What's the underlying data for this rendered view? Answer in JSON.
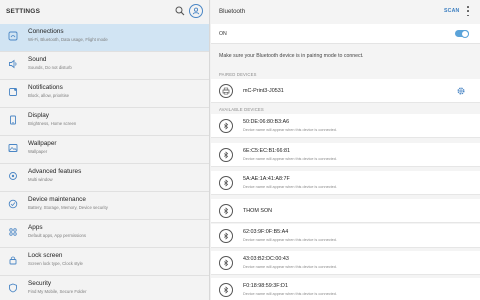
{
  "left": {
    "title": "SETTINGS",
    "items": [
      {
        "title": "Connections",
        "sub": "Wi-Fi, Bluetooth, Data usage, Flight mode",
        "icon": "connections-icon"
      },
      {
        "title": "Sound",
        "sub": "Sounds, Do not disturb",
        "icon": "sound-icon"
      },
      {
        "title": "Notifications",
        "sub": "Block, allow, prioritise",
        "icon": "notifications-icon"
      },
      {
        "title": "Display",
        "sub": "Brightness, Home screen",
        "icon": "display-icon"
      },
      {
        "title": "Wallpaper",
        "sub": "Wallpaper",
        "icon": "wallpaper-icon"
      },
      {
        "title": "Advanced features",
        "sub": "Multi window",
        "icon": "advanced-features-icon"
      },
      {
        "title": "Device maintenance",
        "sub": "Battery, Storage, Memory, Device security",
        "icon": "device-maintenance-icon"
      },
      {
        "title": "Apps",
        "sub": "Default apps, App permissions",
        "icon": "apps-icon"
      },
      {
        "title": "Lock screen",
        "sub": "Screen lock type, Clock style",
        "icon": "lock-icon"
      },
      {
        "title": "Security",
        "sub": "Find My Mobile, Secure Folder",
        "icon": "security-icon"
      }
    ]
  },
  "right": {
    "title": "Bluetooth",
    "scan": "SCAN",
    "on_label": "ON",
    "toggle_on": true,
    "hint": "Make sure your Bluetooth device is in pairing mode to connect.",
    "paired_label": "PAIRED DEVICES",
    "paired": [
      {
        "name": "mC-Print3-J0531"
      }
    ],
    "available_label": "AVAILABLE DEVICES",
    "available": [
      {
        "name": "50:DE:06:80:B3:A6",
        "sub": "Device name will appear when this device is connected."
      },
      {
        "name": "6E:C5:EC:B1:66:81",
        "sub": "Device name will appear when this device is connected."
      },
      {
        "name": "5A:AE:1A:41:A8:7F",
        "sub": "Device name will appear when this device is connected."
      },
      {
        "name": "THOM SON",
        "sub": ""
      },
      {
        "name": "62:03:9F:0F:B5:A4",
        "sub": "Device name will appear when this device is connected."
      },
      {
        "name": "43:03:B2:DC:00:43",
        "sub": "Device name will appear when this device is connected."
      },
      {
        "name": "F0:18:98:59:3F:D1",
        "sub": "Device name will appear when this device is connected."
      }
    ]
  },
  "colors": {
    "accent": "#3b7ec0",
    "active_bg": "#d1e4f3",
    "icon_blue": "#4a86c5"
  }
}
